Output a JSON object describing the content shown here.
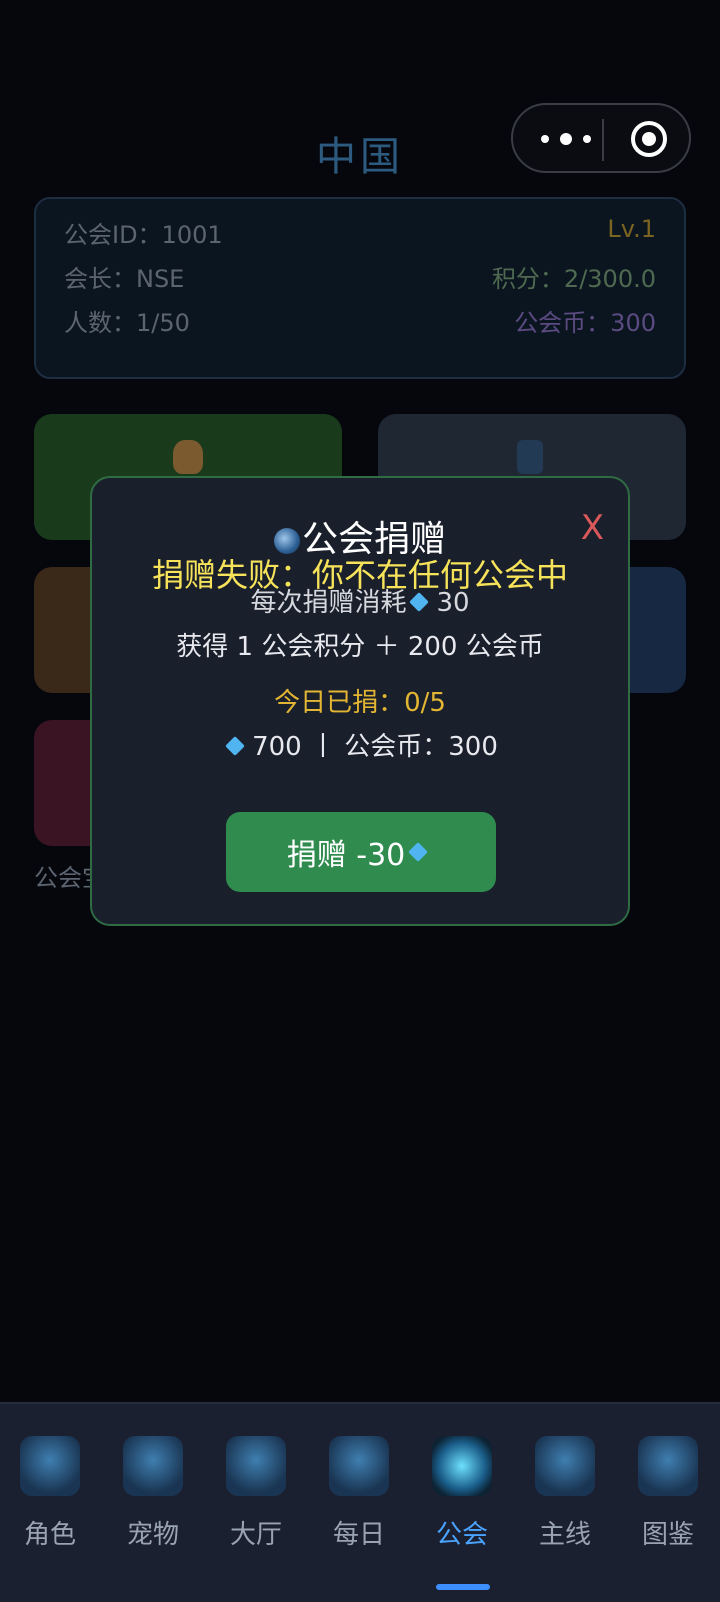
{
  "guild": {
    "name": "中国",
    "id_label": "公会ID：1001",
    "level": "Lv.1",
    "leader_label": "会长：NSE",
    "score_label": "积分：2/300.0",
    "members_label": "人数：1/50",
    "coin_label": "公会币：300"
  },
  "tiles": {
    "bottom_label": "公会宝"
  },
  "modal": {
    "title": "公会捐赠",
    "close": "X",
    "error": "捐赠失败：你不在任何公会中",
    "cost_prefix": "每次捐赠消耗",
    "cost_value": "30",
    "gain": "获得 1 公会积分 ＋ 200 公会币",
    "today": "今日已捐：0/5",
    "balance_gems": "700",
    "balance_rest": "丨 公会币：300",
    "button": "捐赠 -30"
  },
  "nav": {
    "items": [
      {
        "label": "角色",
        "icon": "helmet-icon"
      },
      {
        "label": "宠物",
        "icon": "paw-icon"
      },
      {
        "label": "大厅",
        "icon": "home-icon"
      },
      {
        "label": "每日",
        "icon": "tasks-icon"
      },
      {
        "label": "公会",
        "icon": "swords-icon",
        "active": true
      },
      {
        "label": "主线",
        "icon": "constellation-icon"
      },
      {
        "label": "图鉴",
        "icon": "book-icon"
      }
    ]
  },
  "colors": {
    "accent": "#4aa3ff",
    "button_green": "#2f8c4e",
    "error_yellow": "#f6e35a",
    "close_red": "#d9585a"
  }
}
